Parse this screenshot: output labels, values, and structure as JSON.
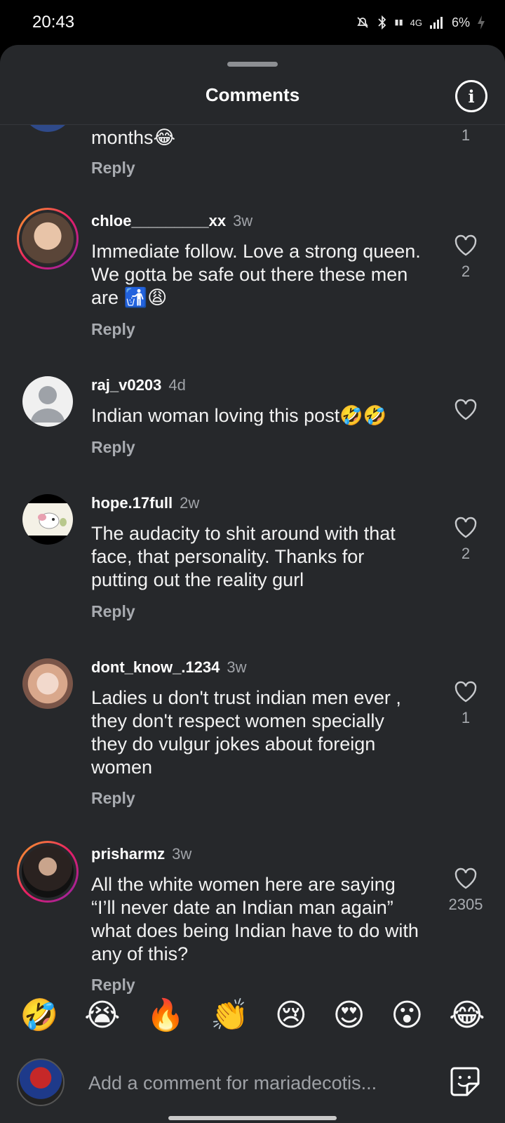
{
  "status": {
    "time": "20:43",
    "battery": "6%",
    "network": "4G"
  },
  "sheet": {
    "title": "Comments"
  },
  "partial_comment": {
    "text": "months😂",
    "reply": "Reply",
    "likes": "1"
  },
  "comments": [
    {
      "username": "chloe_________xx",
      "time": "3w",
      "text": "Immediate follow. Love a strong queen. We gotta be safe out there these men are 🚮😩",
      "reply": "Reply",
      "likes": "2"
    },
    {
      "username": "raj_v0203",
      "time": "4d",
      "text": "Indian woman loving this post🤣🤣",
      "reply": "Reply",
      "likes": ""
    },
    {
      "username": "hope.17full",
      "time": "2w",
      "text": "The audacity to shit around with that face, that personality. Thanks for putting out the reality gurl",
      "reply": "Reply",
      "likes": "2"
    },
    {
      "username": "dont_know_.1234",
      "time": "3w",
      "text": "Ladies u don't trust indian men ever , they don't respect women specially they do vulgur jokes about foreign women",
      "reply": "Reply",
      "likes": "1"
    },
    {
      "username": "prisharmz",
      "time": "3w",
      "text": "All the white women here are saying “I’ll never date an Indian man again” what does being Indian have to do with any of this?",
      "reply": "Reply",
      "likes": "2305"
    }
  ],
  "reactions": [
    "🤣",
    "😭",
    "🔥",
    "👏",
    "😢",
    "😍",
    "😮",
    "😂"
  ],
  "input": {
    "placeholder": "Add a comment for mariadecotis..."
  },
  "colors": {
    "background": "#26282b",
    "text": "#f2f2f2",
    "muted": "#a8abb0"
  }
}
